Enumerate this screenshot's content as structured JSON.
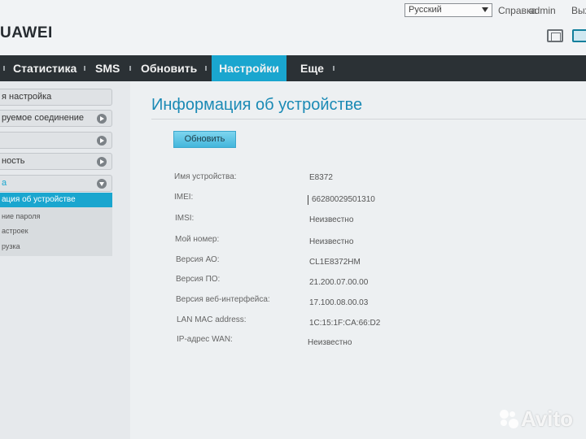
{
  "header": {
    "language": "Русский",
    "help": "Справка",
    "admin": "admin",
    "logout": "Выход",
    "brand": "UAWEI"
  },
  "nav": {
    "items": [
      {
        "label": ""
      },
      {
        "label": "Статистика"
      },
      {
        "label": "SMS"
      },
      {
        "label": "Обновить"
      },
      {
        "label": "Настройки"
      },
      {
        "label": "Еще"
      }
    ],
    "active_color": "#1aa6cf"
  },
  "sidebar": {
    "items": [
      {
        "label": "я настройка"
      },
      {
        "label": "руемое соединение"
      },
      {
        "label": ""
      },
      {
        "label": "ность"
      },
      {
        "label": "а"
      }
    ],
    "submenu": [
      {
        "label": "ация об устройстве"
      },
      {
        "label": "ние пароля"
      },
      {
        "label": "астроек"
      },
      {
        "label": "рузка"
      }
    ]
  },
  "main": {
    "title": "Информация об устройстве",
    "update_button": "Обновить",
    "info": [
      {
        "label": "Имя устройства:",
        "value": "E8372"
      },
      {
        "label": "IMEI:",
        "value": "66280029501310"
      },
      {
        "label": "IMSI:",
        "value": "Неизвестно"
      },
      {
        "label": "Мой номер:",
        "value": "Неизвестно"
      },
      {
        "label": "Версия АО:",
        "value": "CL1E8372HM"
      },
      {
        "label": "Версия ПО:",
        "value": "21.200.07.00.00"
      },
      {
        "label": "Версия веб-интерфейса:",
        "value": "17.100.08.00.03"
      },
      {
        "label": "LAN MAC address:",
        "value": "1C:15:1F:CA:66:D2"
      },
      {
        "label": "IP-адрес WAN:",
        "value": "Неизвестно"
      }
    ]
  },
  "watermark": "Avito"
}
